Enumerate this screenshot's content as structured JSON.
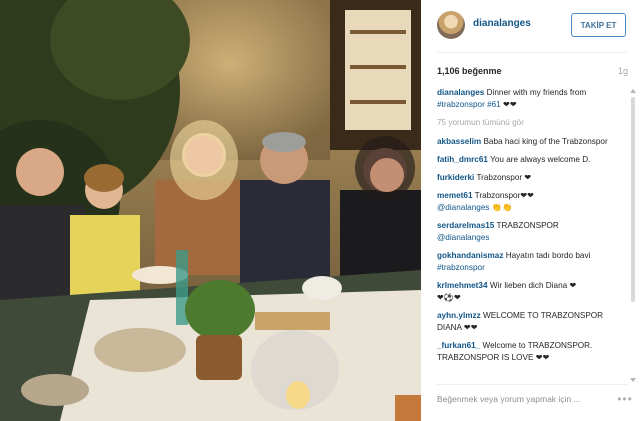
{
  "post": {
    "username": "dianalanges",
    "follow_label": "TAKİP ET",
    "likes": "1,106 beğenme",
    "age": "1g",
    "caption_text": "Dinner with my friends from",
    "caption_tag": "#trabzonspor #61",
    "caption_hearts": "❤❤",
    "view_all": "75 yorumun tümünü gör",
    "comment_placeholder": "Beğenmek veya yorum yapmak için ...",
    "options": "•••"
  },
  "comments": [
    {
      "user": "akbasselim",
      "text": "Baba haci king of the Trabzonspor"
    },
    {
      "user": "fatih_dmrc61",
      "text": "You are always welcome D."
    },
    {
      "user": "furkiderki",
      "text": "Trabzonspor ❤"
    },
    {
      "user": "memet61",
      "text": "Trabzonspor❤❤",
      "tag": "@dianalanges",
      "extra": "👏👏"
    },
    {
      "user": "serdarelmas15",
      "text": "TRABZONSPOR",
      "tag": "@dianalanges"
    },
    {
      "user": "gokhandanismaz",
      "text": "Hayatın tadı bordo bavi",
      "tag": "#trabzonspor"
    },
    {
      "user": "krlmehmet34",
      "text": "Wir lieben dich Diana ❤",
      "extra": "❤⚽❤"
    },
    {
      "user": "ayhn.ylmzz",
      "text": "WELCOME TO TRABZONSPOR DIANA ❤❤"
    },
    {
      "user": "_furkan61_",
      "text": "Welcome to TRABZONSPOR. TRABZONSPOR IS LOVE ❤❤"
    }
  ]
}
